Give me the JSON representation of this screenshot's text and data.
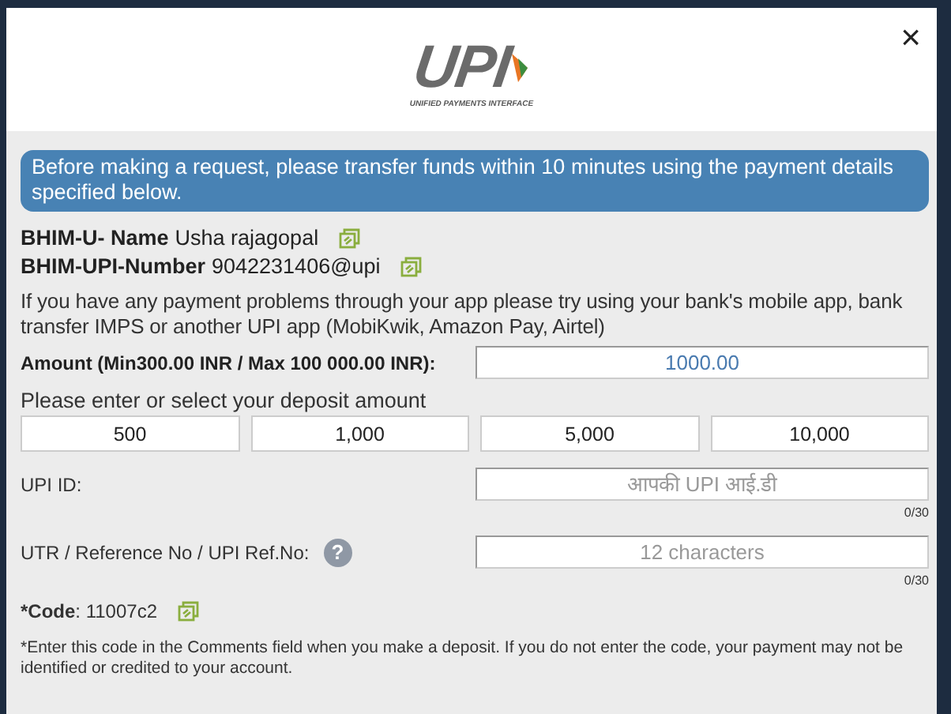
{
  "logo": {
    "wordmark": "UPI",
    "tagline": "UNIFIED PAYMENTS INTERFACE"
  },
  "close": "×",
  "notice": "Before making a request, please transfer funds within 10 minutes using the payment details specified below.",
  "details": [
    {
      "label": "BHIM-U- Name",
      "value": "Usha rajagopal"
    },
    {
      "label": "BHIM-UPI-Number",
      "value": "9042231406@upi"
    }
  ],
  "help_text": "If you have any payment problems through your app please try using your bank's mobile app, bank transfer IMPS or another UPI app (MobiKwik, Amazon Pay, Airtel)",
  "amount": {
    "label": "Amount (Min300.00 INR / Max 100 000.00 INR):",
    "value": "1000.00"
  },
  "deposit_prompt": "Please enter or select your deposit amount",
  "presets": [
    "500",
    "1,000",
    "5,000",
    "10,000"
  ],
  "fields": [
    {
      "label": "UPI ID:",
      "placeholder": "आपकी UPI आई.डी",
      "counter": "0/30",
      "help": false
    },
    {
      "label": "UTR / Reference No / UPI Ref.No:",
      "placeholder": "12 characters",
      "counter": "0/30",
      "help": true,
      "help_glyph": "?"
    }
  ],
  "code": {
    "label": "*Code",
    "value": ": 11007c2"
  },
  "footnote": "*Enter this code in the Comments field when you make a deposit. If you do not enter the code, your payment may not be identified or credited to your account."
}
